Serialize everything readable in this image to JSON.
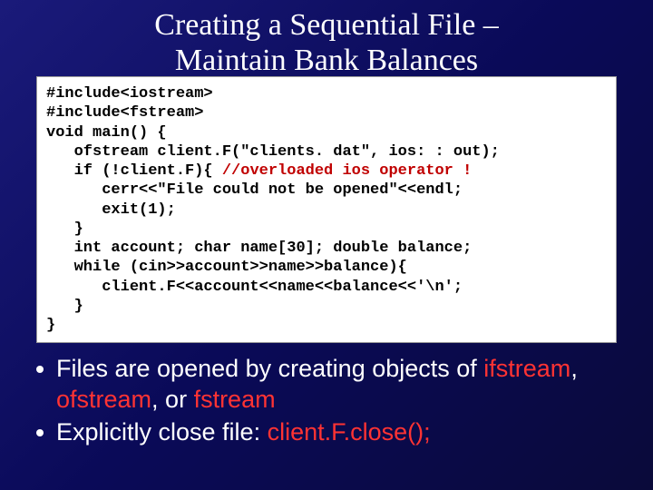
{
  "title_line1": "Creating a Sequential File –",
  "title_line2": "Maintain Bank Balances",
  "code": {
    "l1": "#include<iostream>",
    "l2": "#include<fstream>",
    "l3": "void main() {",
    "l4": "   ofstream client.F(\"clients. dat\", ios: : out);",
    "l5a": "   if (!client.F){ ",
    "l5b": "//overloaded ios operator !",
    "l6": "      cerr<<\"File could not be opened\"<<endl;",
    "l7": "      exit(1);",
    "l8": "   }",
    "l9": "   int account; char name[30]; double balance;",
    "l10": "   while (cin>>account>>name>>balance){",
    "l11": "      client.F<<account<<name<<balance<<'\\n';",
    "l12": "   }",
    "l13": "}"
  },
  "bullets": {
    "b1_pre": "Files are opened by creating objects of ",
    "b1_k1": "ifstream",
    "b1_s1": ", ",
    "b1_k2": "ofstream",
    "b1_s2": ", or ",
    "b1_k3": "fstream",
    "b2_pre": "Explicitly close file: ",
    "b2_k1": "client.F.close();"
  }
}
